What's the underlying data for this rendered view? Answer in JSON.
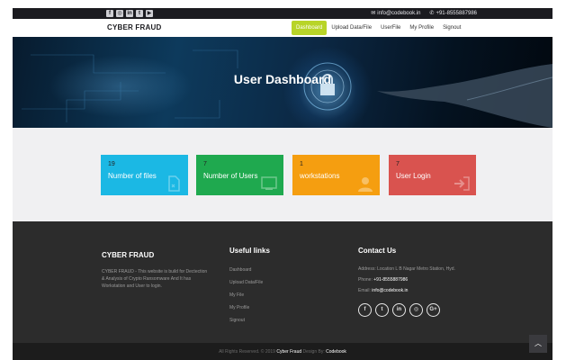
{
  "topbar": {
    "social_icons": [
      "facebook-icon",
      "instagram-icon",
      "linkedin-icon",
      "twitter-icon",
      "youtube-icon"
    ],
    "email": "info@codebook.in",
    "phone": "+91-8555887986"
  },
  "nav": {
    "brand": "CYBER FRAUD",
    "items": [
      {
        "label": "Dashboard",
        "active": true
      },
      {
        "label": "Upload Data/File",
        "active": false
      },
      {
        "label": "UserFile",
        "active": false
      },
      {
        "label": "My Profile",
        "active": false
      },
      {
        "label": "Signout",
        "active": false
      }
    ]
  },
  "hero": {
    "title": "User Dashboard"
  },
  "cards": [
    {
      "value": "19",
      "label": "Number of files",
      "color": "#1bb8e4",
      "icon": "file-icon"
    },
    {
      "value": "7",
      "label": "Number of Users",
      "color": "#1fa94f",
      "icon": "users-icon"
    },
    {
      "value": "1",
      "label": "workstations",
      "color": "#f59e10",
      "icon": "user-icon"
    },
    {
      "value": "7",
      "label": "User Login",
      "color": "#d9534f",
      "icon": "sign-in-icon"
    }
  ],
  "footer": {
    "about": {
      "title": "CYBER FRAUD",
      "text": "CYBER FRAUD - This website is build for Dectection & Analysis of Crypto Ransomware And It has Workstation and User to login."
    },
    "links": {
      "title": "Useful links",
      "items": [
        "Dashboard",
        "Upload Data/File",
        "My File",
        "My Profile",
        "Signout"
      ]
    },
    "contact": {
      "title": "Contact Us",
      "address_label": "Address:",
      "address": "Location L B Nagar Metro Station, Hyd.",
      "phone_label": "Phone:",
      "phone": "+91-8555887986",
      "email_label": "Email:",
      "email": "info@codebook.in",
      "social": [
        "facebook-icon",
        "twitter-icon",
        "linkedin-icon",
        "instagram-icon",
        "google-plus-icon"
      ]
    }
  },
  "bottombar": {
    "copy_prefix": "All Rights Reserved. © 2019",
    "site": "Cyber Fraud",
    "design_by": "Design By:",
    "designer": "Codebook"
  },
  "colors": {
    "accent": "#b8d428",
    "cyan": "#1bb8e4",
    "green": "#1fa94f",
    "orange": "#f59e10",
    "red": "#d9534f"
  }
}
